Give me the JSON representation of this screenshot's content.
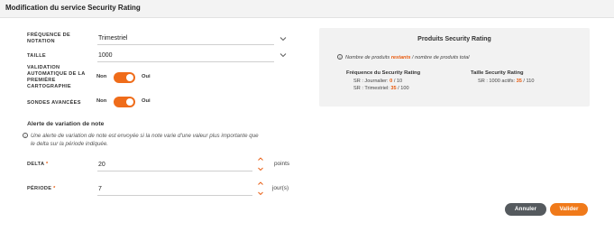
{
  "header": {
    "title": "Modification du service Security Rating"
  },
  "form": {
    "frequency": {
      "label_line1": "FRÉQUENCE DE",
      "label_line2": "NOTATION",
      "value": "Trimestriel"
    },
    "size": {
      "label": "TAILLE",
      "value": "1000"
    },
    "auto_validation": {
      "label_lines": [
        "VALIDATION",
        "AUTOMATIQUE DE LA",
        "PREMIÈRE",
        "CARTOGRAPHIE"
      ],
      "off_label": "Non",
      "on_label": "Oui",
      "state": "on"
    },
    "advanced_probes": {
      "label": "SONDES AVANCÉES",
      "off_label": "Non",
      "on_label": "Oui",
      "state": "on"
    }
  },
  "alert": {
    "title": "Alerte de variation de note",
    "info_line1": "Une alerte de variation de note est envoyée si la note varie d'une valeur plus importante que",
    "info_line2": "le delta sur la période indiquée.",
    "delta": {
      "label": "DELTA",
      "required_mark": "*",
      "value": "20",
      "unit": "points"
    },
    "period": {
      "label": "PÉRIODE",
      "required_mark": "*",
      "value": "7",
      "unit": "jour(s)"
    }
  },
  "panel": {
    "title": "Produits Security Rating",
    "info_prefix": "Nombre de produits ",
    "info_highlight": "restants",
    "info_suffix": " / nombre de produits total",
    "freq_title": "Fréquence du Security Rating",
    "freq_daily_label": "SR : Journalier:",
    "freq_daily_remaining": "0",
    "freq_daily_total": "/ 10",
    "freq_quarterly_label": "SR : Trimestriel:",
    "freq_quarterly_remaining": "35",
    "freq_quarterly_total": "/ 100",
    "size_title": "Taille Security Rating",
    "size_label": "SR : 1000 actifs:",
    "size_remaining": "35",
    "size_total": "/ 110"
  },
  "actions": {
    "cancel_label": "Annuler",
    "submit_label": "Valider"
  },
  "colors": {
    "accent": "#ef6c1a",
    "cancel": "#555a5e"
  },
  "icons": [
    "chevron-down-icon",
    "info-icon",
    "chevron-up-icon"
  ]
}
